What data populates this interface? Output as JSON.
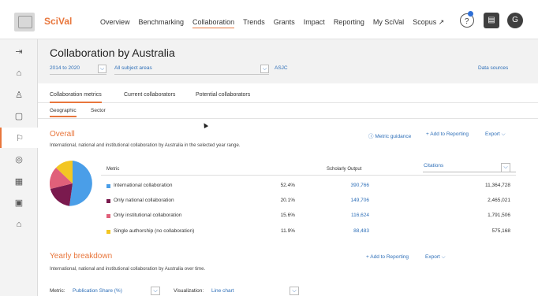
{
  "app": {
    "brand": "SciVal"
  },
  "nav": {
    "items": [
      "Overview",
      "Benchmarking",
      "Collaboration",
      "Trends",
      "Grants",
      "Impact",
      "Reporting",
      "My SciVal",
      "Scopus ↗"
    ],
    "active": "Collaboration"
  },
  "header_icons": {
    "help": "question-circle-icon",
    "institution": "building-icon",
    "user_initial": "G"
  },
  "sidebar": {
    "icons": [
      "expand-icon",
      "institution-icon",
      "person-icon",
      "folder-icon",
      "flag-icon",
      "compass-icon",
      "grid-icon",
      "calendar-icon",
      "home-icon"
    ]
  },
  "page": {
    "title": "Collaboration by Australia",
    "year_range": "2014 to 2020",
    "subject": "All subject areas",
    "asjc": "ASJC",
    "data_sources": "Data sources"
  },
  "tabs": [
    "Collaboration metrics",
    "Current collaborators",
    "Potential collaborators"
  ],
  "subtabs": [
    "Geographic",
    "Sector"
  ],
  "overall": {
    "title": "Overall",
    "description": "International, national and institutional collaboration by Australia in the selected year range.",
    "metric_guidance": "Metric guidance",
    "add_to_reporting": "+ Add to Reporting",
    "export": "Export ⌵"
  },
  "table": {
    "headers": {
      "metric": "Metric",
      "scholarly_output": "Scholarly Output",
      "citations": "Citations"
    },
    "rows": [
      {
        "label": "International collaboration",
        "color": "#4a9ee8",
        "share": "52.4%",
        "output": "390,766",
        "citations": "11,364,728"
      },
      {
        "label": "Only national collaboration",
        "color": "#7a1a4e",
        "share": "20.1%",
        "output": "149,706",
        "citations": "2,465,021"
      },
      {
        "label": "Only institutional collaboration",
        "color": "#e0607a",
        "share": "15.6%",
        "output": "116,624",
        "citations": "1,791,506"
      },
      {
        "label": "Single authorship (no collaboration)",
        "color": "#f3c623",
        "share": "11.9%",
        "output": "88,483",
        "citations": "575,168"
      }
    ]
  },
  "yearly": {
    "title": "Yearly breakdown",
    "description": "International, national and institutional collaboration by Australia over time.",
    "add_to_reporting": "+ Add to Reporting",
    "export": "Export ⌵",
    "metric_label": "Metric:",
    "metric_value": "Publication Share (%)",
    "viz_label": "Visualization:",
    "viz_value": "Line chart"
  }
}
